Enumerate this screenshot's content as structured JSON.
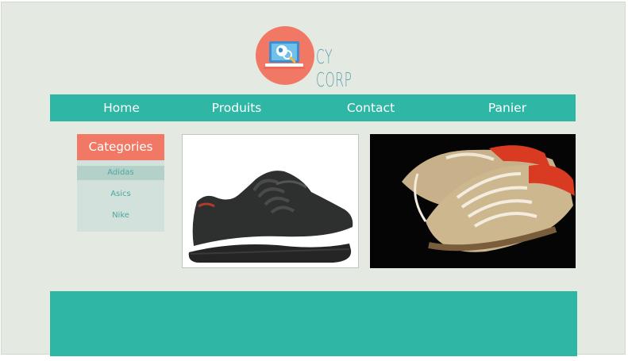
{
  "brand": {
    "name": "CY CORP",
    "logo_icon": "laptop-search-icon",
    "colors": {
      "primary": "#2fb6a4",
      "accent": "#f07865",
      "background": "#e4e9e1"
    }
  },
  "nav": {
    "items": [
      {
        "label": "Home"
      },
      {
        "label": "Produits"
      },
      {
        "label": "Contact"
      },
      {
        "label": "Panier"
      }
    ]
  },
  "sidebar": {
    "title": "Categories",
    "items": [
      {
        "label": "Adidas",
        "selected": true
      },
      {
        "label": "Asics",
        "selected": false
      },
      {
        "label": "Nike",
        "selected": false
      }
    ]
  },
  "products": [
    {
      "image": "black-sneaker-photo"
    },
    {
      "image": "tan-sneakers-photo"
    }
  ]
}
